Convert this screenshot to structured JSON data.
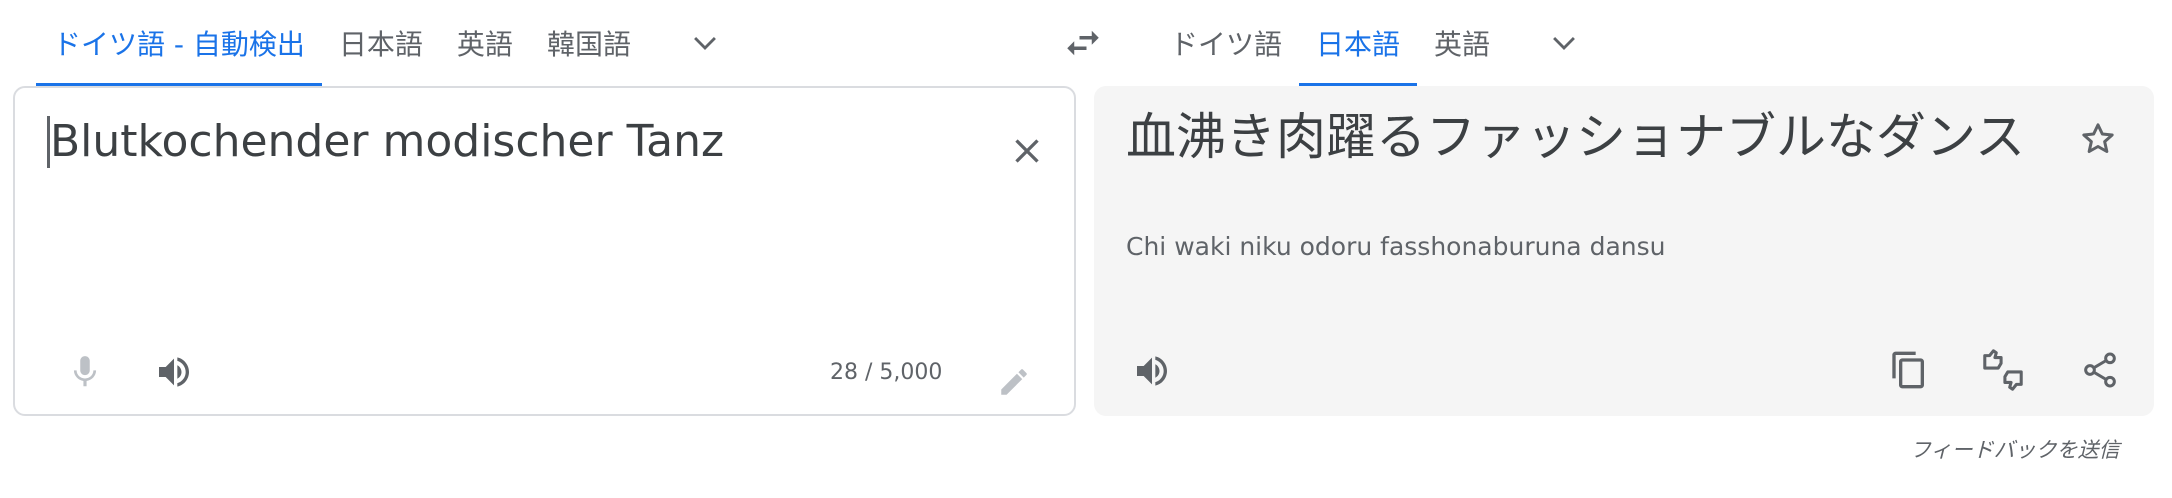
{
  "source_langs": {
    "tabs": [
      {
        "label": "ドイツ語 - 自動検出",
        "active": true
      },
      {
        "label": "日本語",
        "active": false
      },
      {
        "label": "英語",
        "active": false
      },
      {
        "label": "韓国語",
        "active": false
      }
    ],
    "more_icon": "chevron-down-icon"
  },
  "swap_icon": "swap-horiz-icon",
  "target_langs": {
    "tabs": [
      {
        "label": "ドイツ語",
        "active": false
      },
      {
        "label": "日本語",
        "active": true
      },
      {
        "label": "英語",
        "active": false
      }
    ],
    "more_icon": "chevron-down-icon"
  },
  "source": {
    "text": "Blutkochender modischer Tanz",
    "char_count": "28 / 5,000",
    "icons": [
      "mic-icon",
      "speaker-icon",
      "pencil-icon",
      "close-icon"
    ]
  },
  "target": {
    "text": "血沸き肉躍るファッショナブルなダンス",
    "romanization": "Chi waki niku odoru fasshonaburuna dansu",
    "icons": [
      "star-icon",
      "speaker-icon",
      "copy-icon",
      "feedback-icon",
      "share-icon"
    ]
  },
  "feedback_link": "フィードバックを送信",
  "colors": {
    "accent": "#1a73e8",
    "text": "#3c4043",
    "muted": "#5f6368",
    "target_bg": "#f5f5f5",
    "border": "#dadce0"
  }
}
